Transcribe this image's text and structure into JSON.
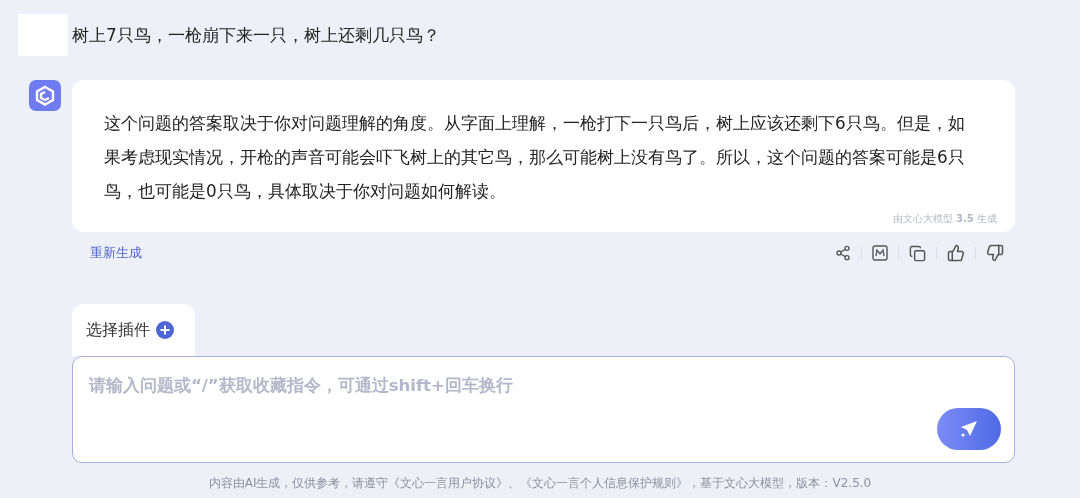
{
  "user_message": {
    "text": "树上7只鸟，一枪崩下来一只，树上还剩几只鸟？"
  },
  "bot_message": {
    "text": "这个问题的答案取决于你对问题理解的角度。从字面上理解，一枪打下一只鸟后，树上应该还剩下6只鸟。但是，如果考虑现实情况，开枪的声音可能会吓飞树上的其它鸟，那么可能树上没有鸟了。所以，这个问题的答案可能是6只鸟，也可能是0只鸟，具体取决于你对问题如何解读。",
    "model_note": "由文心大模型 **3.5** 生成"
  },
  "regenerate_link": "重新生成",
  "plugin_tab": {
    "label": "选择插件"
  },
  "input": {
    "placeholder": "请输入问题或“/”获取收藏指令，可通过shift+回车换行"
  },
  "disclaimer": "内容由AI生成，仅供参考，请遵守《文心一言用户协议》、《文心一言个人信息保护规则》，基于文心大模型，版本：V2.5.0"
}
